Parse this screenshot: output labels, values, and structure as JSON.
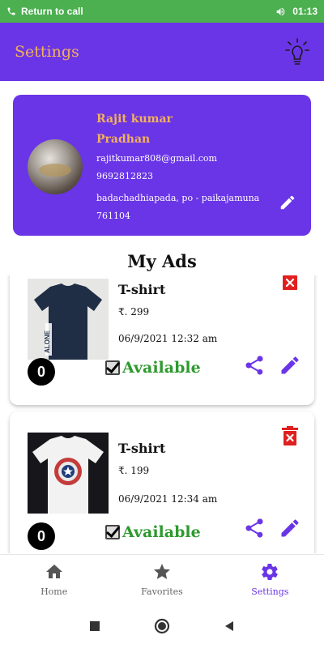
{
  "status_bar": {
    "call_text": "Return to call",
    "time": "01:13"
  },
  "app_bar": {
    "title": "Settings",
    "bulb_icon": "lightbulb-icon"
  },
  "profile": {
    "name": "Rajit kumar Pradhan",
    "email": "rajitkumar808@gmail.com",
    "phone": "9692812823",
    "address": "badachadhiapada, po - paikajamuna 761104"
  },
  "my_ads_title": "My Ads",
  "ads": [
    {
      "title": "T-shirt",
      "price": "₹. 299",
      "date": "06/9/2021 12:32 am",
      "count": "0",
      "status": "Available",
      "image_label": "ALONE"
    },
    {
      "title": "T-shirt",
      "price": "₹. 199",
      "date": "06/9/2021 12:34 am",
      "count": "0",
      "status": "Available"
    }
  ],
  "bottom_nav": [
    {
      "label": "Home",
      "icon": "home-icon"
    },
    {
      "label": "Favorites",
      "icon": "star-icon"
    },
    {
      "label": "Settings",
      "icon": "gear-icon",
      "active": true
    }
  ],
  "colors": {
    "primary": "#6a35e6",
    "accent": "#f4b15a",
    "available": "#2e9a2e",
    "delete": "#e02020",
    "statusbar": "#4caf50"
  }
}
